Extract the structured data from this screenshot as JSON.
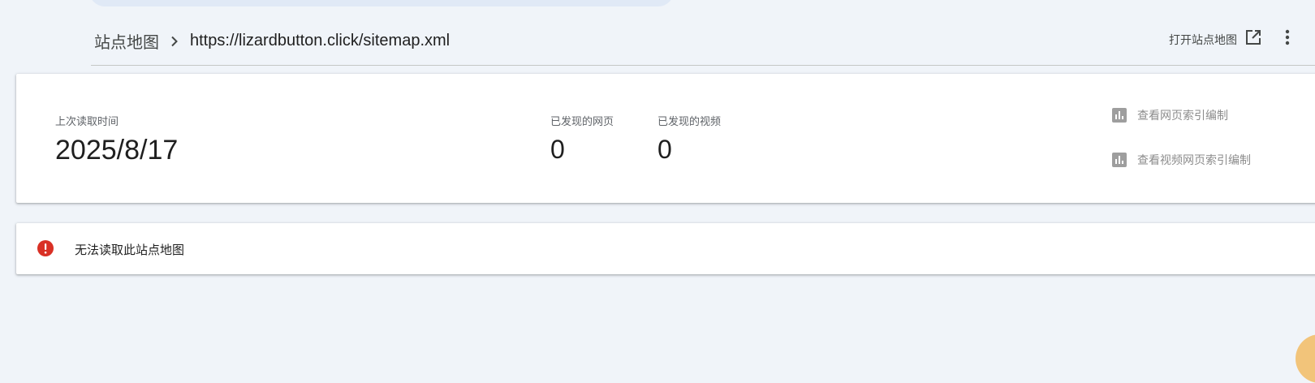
{
  "breadcrumb": {
    "root": "站点地图",
    "current": "https://lizardbutton.click/sitemap.xml"
  },
  "header": {
    "open_sitemap_label": "打开站点地图"
  },
  "stats": {
    "last_read_label": "上次读取时间",
    "last_read_value": "2025/8/17",
    "pages_label": "已发现的网页",
    "pages_value": "0",
    "videos_label": "已发现的视频",
    "videos_value": "0"
  },
  "actions": {
    "page_indexing": "查看网页索引编制",
    "video_indexing": "查看视频网页索引编制"
  },
  "error": {
    "message": "无法读取此站点地图"
  },
  "colors": {
    "background": "#f0f4f9",
    "error": "#d93025",
    "muted_icon": "#9e9e9e",
    "accent_blob": "#f2c47a"
  }
}
